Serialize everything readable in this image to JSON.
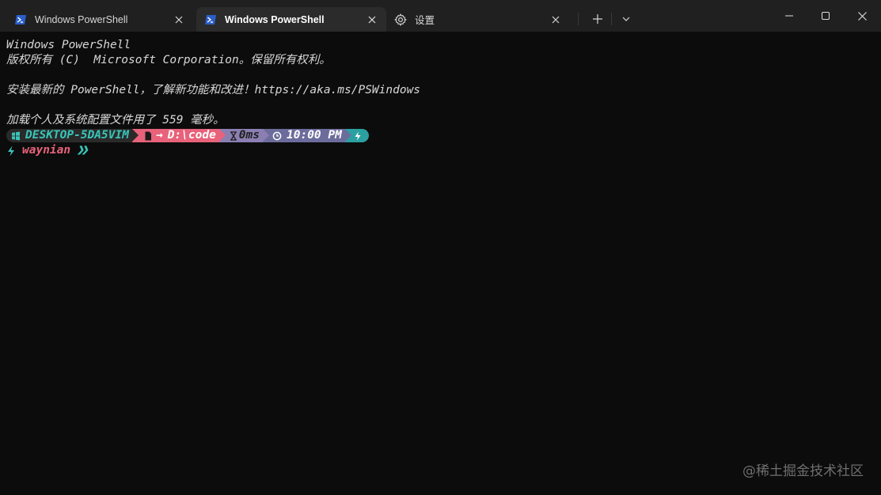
{
  "tabs": [
    {
      "label": "Windows PowerShell",
      "icon": "powershell-icon",
      "active": false
    },
    {
      "label": "Windows PowerShell",
      "icon": "powershell-icon",
      "active": true
    },
    {
      "label": "设置",
      "icon": "gear-icon",
      "active": false
    }
  ],
  "terminal": {
    "lines": [
      "Windows PowerShell",
      "版权所有 (C)  Microsoft Corporation。保留所有权利。",
      "",
      "安装最新的 PowerShell，了解新功能和改进！https://aka.ms/PSWindows",
      "",
      "加载个人及系统配置文件用了 559 毫秒。"
    ],
    "prompt": {
      "host": "DESKTOP-5DA5VIM",
      "path_arrow": "→",
      "path": "D:\\code",
      "duration": "0ms",
      "time": "10:00 PM"
    },
    "user": {
      "name": "waynian",
      "chevrons": "❯❯"
    }
  },
  "watermark": "@稀土掘金技术社区",
  "colors": {
    "background": "#0c0c0c",
    "titlebar": "#202020",
    "active_tab": "#2b2b2b",
    "host_accent": "#39c5b9",
    "path_segment": "#e7627a",
    "time_segment": "#8b7fb2",
    "clock_segment": "#6c6c9c",
    "status_segment": "#2ba0a0"
  }
}
